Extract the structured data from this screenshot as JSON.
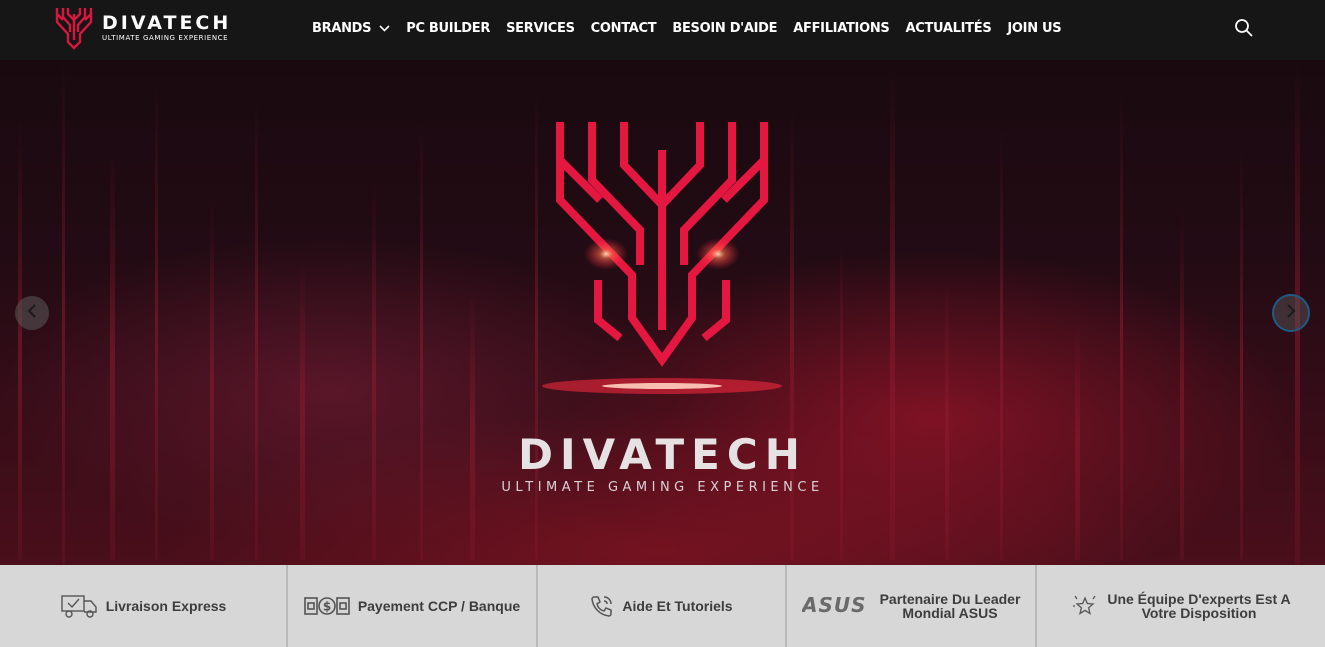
{
  "header": {
    "logo_name": "DIVATECH",
    "logo_tagline": "ULTIMATE GAMING EXPERIENCE",
    "nav": [
      {
        "label": "BRANDS",
        "has_dropdown": true
      },
      {
        "label": "PC BUILDER"
      },
      {
        "label": "SERVICES"
      },
      {
        "label": "CONTACT"
      },
      {
        "label": "BESOIN D'AIDE"
      },
      {
        "label": "AFFILIATIONS"
      },
      {
        "label": "ACTUALITÉS"
      },
      {
        "label": "JOIN US"
      }
    ],
    "search_icon": "search-icon"
  },
  "hero": {
    "title": "DIVATECH",
    "subtitle": "ULTIMATE GAMING EXPERIENCE",
    "prev_icon": "chevron-left-icon",
    "next_icon": "chevron-right-icon"
  },
  "features": [
    {
      "icon": "delivery-truck-icon",
      "label_lines": [
        "Livraison Express"
      ]
    },
    {
      "icon": "banknote-icon",
      "label_lines": [
        "Payement CCP / Banque"
      ]
    },
    {
      "icon": "phone-icon",
      "label_lines": [
        "Aide Et Tutoriels"
      ]
    },
    {
      "icon": "asus-logo",
      "logo_text": "ASUS",
      "label_lines": [
        "Partenaire Du Leader",
        "Mondial ASUS"
      ]
    },
    {
      "icon": "star-icon",
      "label_lines": [
        "Une Équipe D'experts Est A",
        "Votre Disposition"
      ]
    }
  ],
  "colors": {
    "brand_red": "#d8173f",
    "header_bg": "#161616",
    "features_bg": "#d7d7d7",
    "focus_ring": "#1e5c8a"
  }
}
